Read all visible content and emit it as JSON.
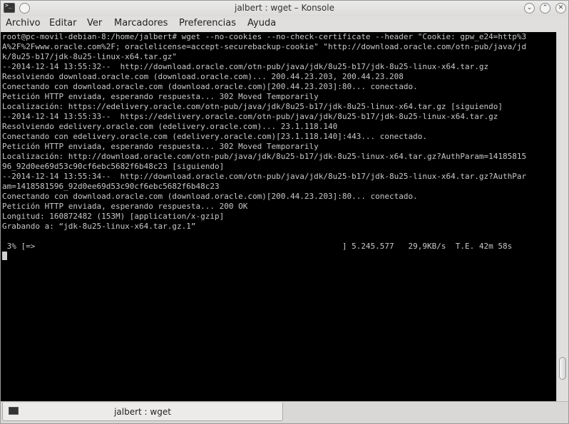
{
  "window": {
    "title": "jalbert : wget – Konsole",
    "controls": {
      "minimize": "⌄",
      "maximize": "⌃",
      "close": "✕"
    }
  },
  "menubar": {
    "items": [
      "Archivo",
      "Editar",
      "Ver",
      "Marcadores",
      "Preferencias",
      "Ayuda"
    ]
  },
  "terminal": {
    "lines": [
      "root@pc-movil-debian-8:/home/jalbert# wget --no-cookies --no-check-certificate --header \"Cookie: gpw_e24=http%3",
      "A%2F%2Fwww.oracle.com%2F; oraclelicense=accept-securebackup-cookie\" \"http://download.oracle.com/otn-pub/java/jd",
      "k/8u25-b17/jdk-8u25-linux-x64.tar.gz\"",
      "--2014-12-14 13:55:32--  http://download.oracle.com/otn-pub/java/jdk/8u25-b17/jdk-8u25-linux-x64.tar.gz",
      "Resolviendo download.oracle.com (download.oracle.com)... 200.44.23.203, 200.44.23.208",
      "Conectando con download.oracle.com (download.oracle.com)[200.44.23.203]:80... conectado.",
      "Petición HTTP enviada, esperando respuesta... 302 Moved Temporarily",
      "Localización: https://edelivery.oracle.com/otn-pub/java/jdk/8u25-b17/jdk-8u25-linux-x64.tar.gz [siguiendo]",
      "--2014-12-14 13:55:33--  https://edelivery.oracle.com/otn-pub/java/jdk/8u25-b17/jdk-8u25-linux-x64.tar.gz",
      "Resolviendo edelivery.oracle.com (edelivery.oracle.com)... 23.1.118.140",
      "Conectando con edelivery.oracle.com (edelivery.oracle.com)[23.1.118.140]:443... conectado.",
      "Petición HTTP enviada, esperando respuesta... 302 Moved Temporarily",
      "Localización: http://download.oracle.com/otn-pub/java/jdk/8u25-b17/jdk-8u25-linux-x64.tar.gz?AuthParam=14185815",
      "96_92d0ee69d53c90cf6ebc5682f6b48c23 [siguiendo]",
      "--2014-12-14 13:55:34--  http://download.oracle.com/otn-pub/java/jdk/8u25-b17/jdk-8u25-linux-x64.tar.gz?AuthPar",
      "am=1418581596_92d0ee69d53c90cf6ebc5682f6b48c23",
      "Conectando con download.oracle.com (download.oracle.com)[200.44.23.203]:80... conectado.",
      "Petición HTTP enviada, esperando respuesta... 200 OK",
      "Longitud: 160872482 (153M) [application/x-gzip]",
      "Grabando a: “jdk-8u25-linux-x64.tar.gz.1”",
      "",
      " 3% [=>                                                                 ] 5.245.577   29,9KB/s  T.E. 42m 58s"
    ]
  },
  "tabbar": {
    "tabs": [
      {
        "label": "jalbert : wget"
      }
    ]
  },
  "colors": {
    "terminal_bg": "#000000",
    "terminal_fg": "#c8c8c8",
    "chrome_bg": "#e0dfde"
  }
}
